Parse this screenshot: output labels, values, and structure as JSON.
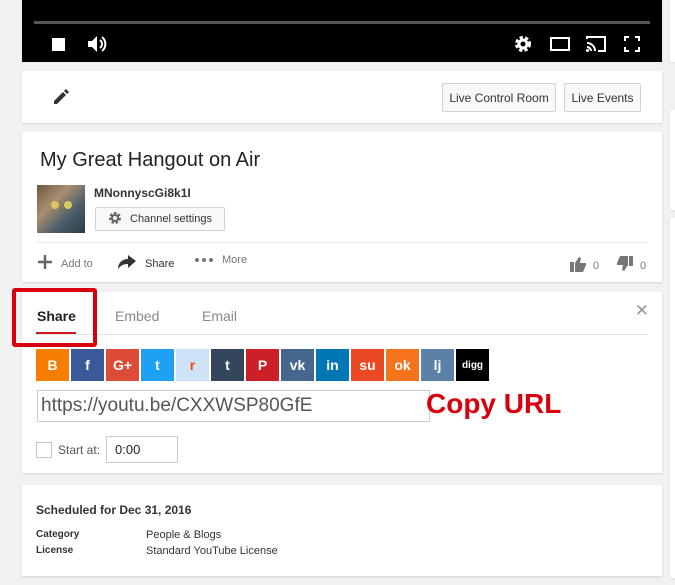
{
  "player": {
    "controls": [
      "stop-icon",
      "volume-icon",
      "settings-icon",
      "theater-mode-icon",
      "cast-icon",
      "fullscreen-icon"
    ]
  },
  "toolbar": {
    "live_control_room": "Live Control Room",
    "live_events": "Live Events"
  },
  "video": {
    "title": "My Great Hangout on Air",
    "channel_name": "MNonnyscGi8k1I",
    "channel_settings": "Channel settings",
    "actions": {
      "add_to": "Add to",
      "share": "Share",
      "more": "More"
    },
    "likes": "0",
    "dislikes": "0"
  },
  "share_panel": {
    "tabs": [
      "Share",
      "Embed",
      "Email"
    ],
    "active_tab": "Share",
    "social": [
      {
        "name": "blogger",
        "glyph": "B",
        "color": "#f57d00"
      },
      {
        "name": "facebook",
        "glyph": "f",
        "color": "#3b5998"
      },
      {
        "name": "google-plus",
        "glyph": "G+",
        "color": "#dd4b39"
      },
      {
        "name": "twitter",
        "glyph": "t",
        "color": "#1da1f2"
      },
      {
        "name": "reddit",
        "glyph": "r",
        "color": "#cee3f8"
      },
      {
        "name": "tumblr",
        "glyph": "t",
        "color": "#35465c"
      },
      {
        "name": "pinterest",
        "glyph": "P",
        "color": "#cb2027"
      },
      {
        "name": "vk",
        "glyph": "vk",
        "color": "#45668e"
      },
      {
        "name": "linkedin",
        "glyph": "in",
        "color": "#0077b5"
      },
      {
        "name": "stumbleupon",
        "glyph": "su",
        "color": "#eb4924"
      },
      {
        "name": "odnoklassniki",
        "glyph": "ok",
        "color": "#f4731c"
      },
      {
        "name": "livejournal",
        "glyph": "lj",
        "color": "#5c81a8"
      },
      {
        "name": "digg",
        "glyph": "digg",
        "color": "#000000"
      }
    ],
    "url": "https://youtu.be/CXXWSP80GfE",
    "annotation": "Copy URL",
    "start_at_label": "Start at:",
    "start_at_value": "0:00"
  },
  "meta": {
    "scheduled": "Scheduled for Dec 31, 2016",
    "rows": [
      {
        "key": "Category",
        "value": "People & Blogs"
      },
      {
        "key": "License",
        "value": "Standard YouTube License"
      }
    ]
  },
  "colors": {
    "accent_red": "#cc181e",
    "annotation_red": "#d8000c"
  }
}
